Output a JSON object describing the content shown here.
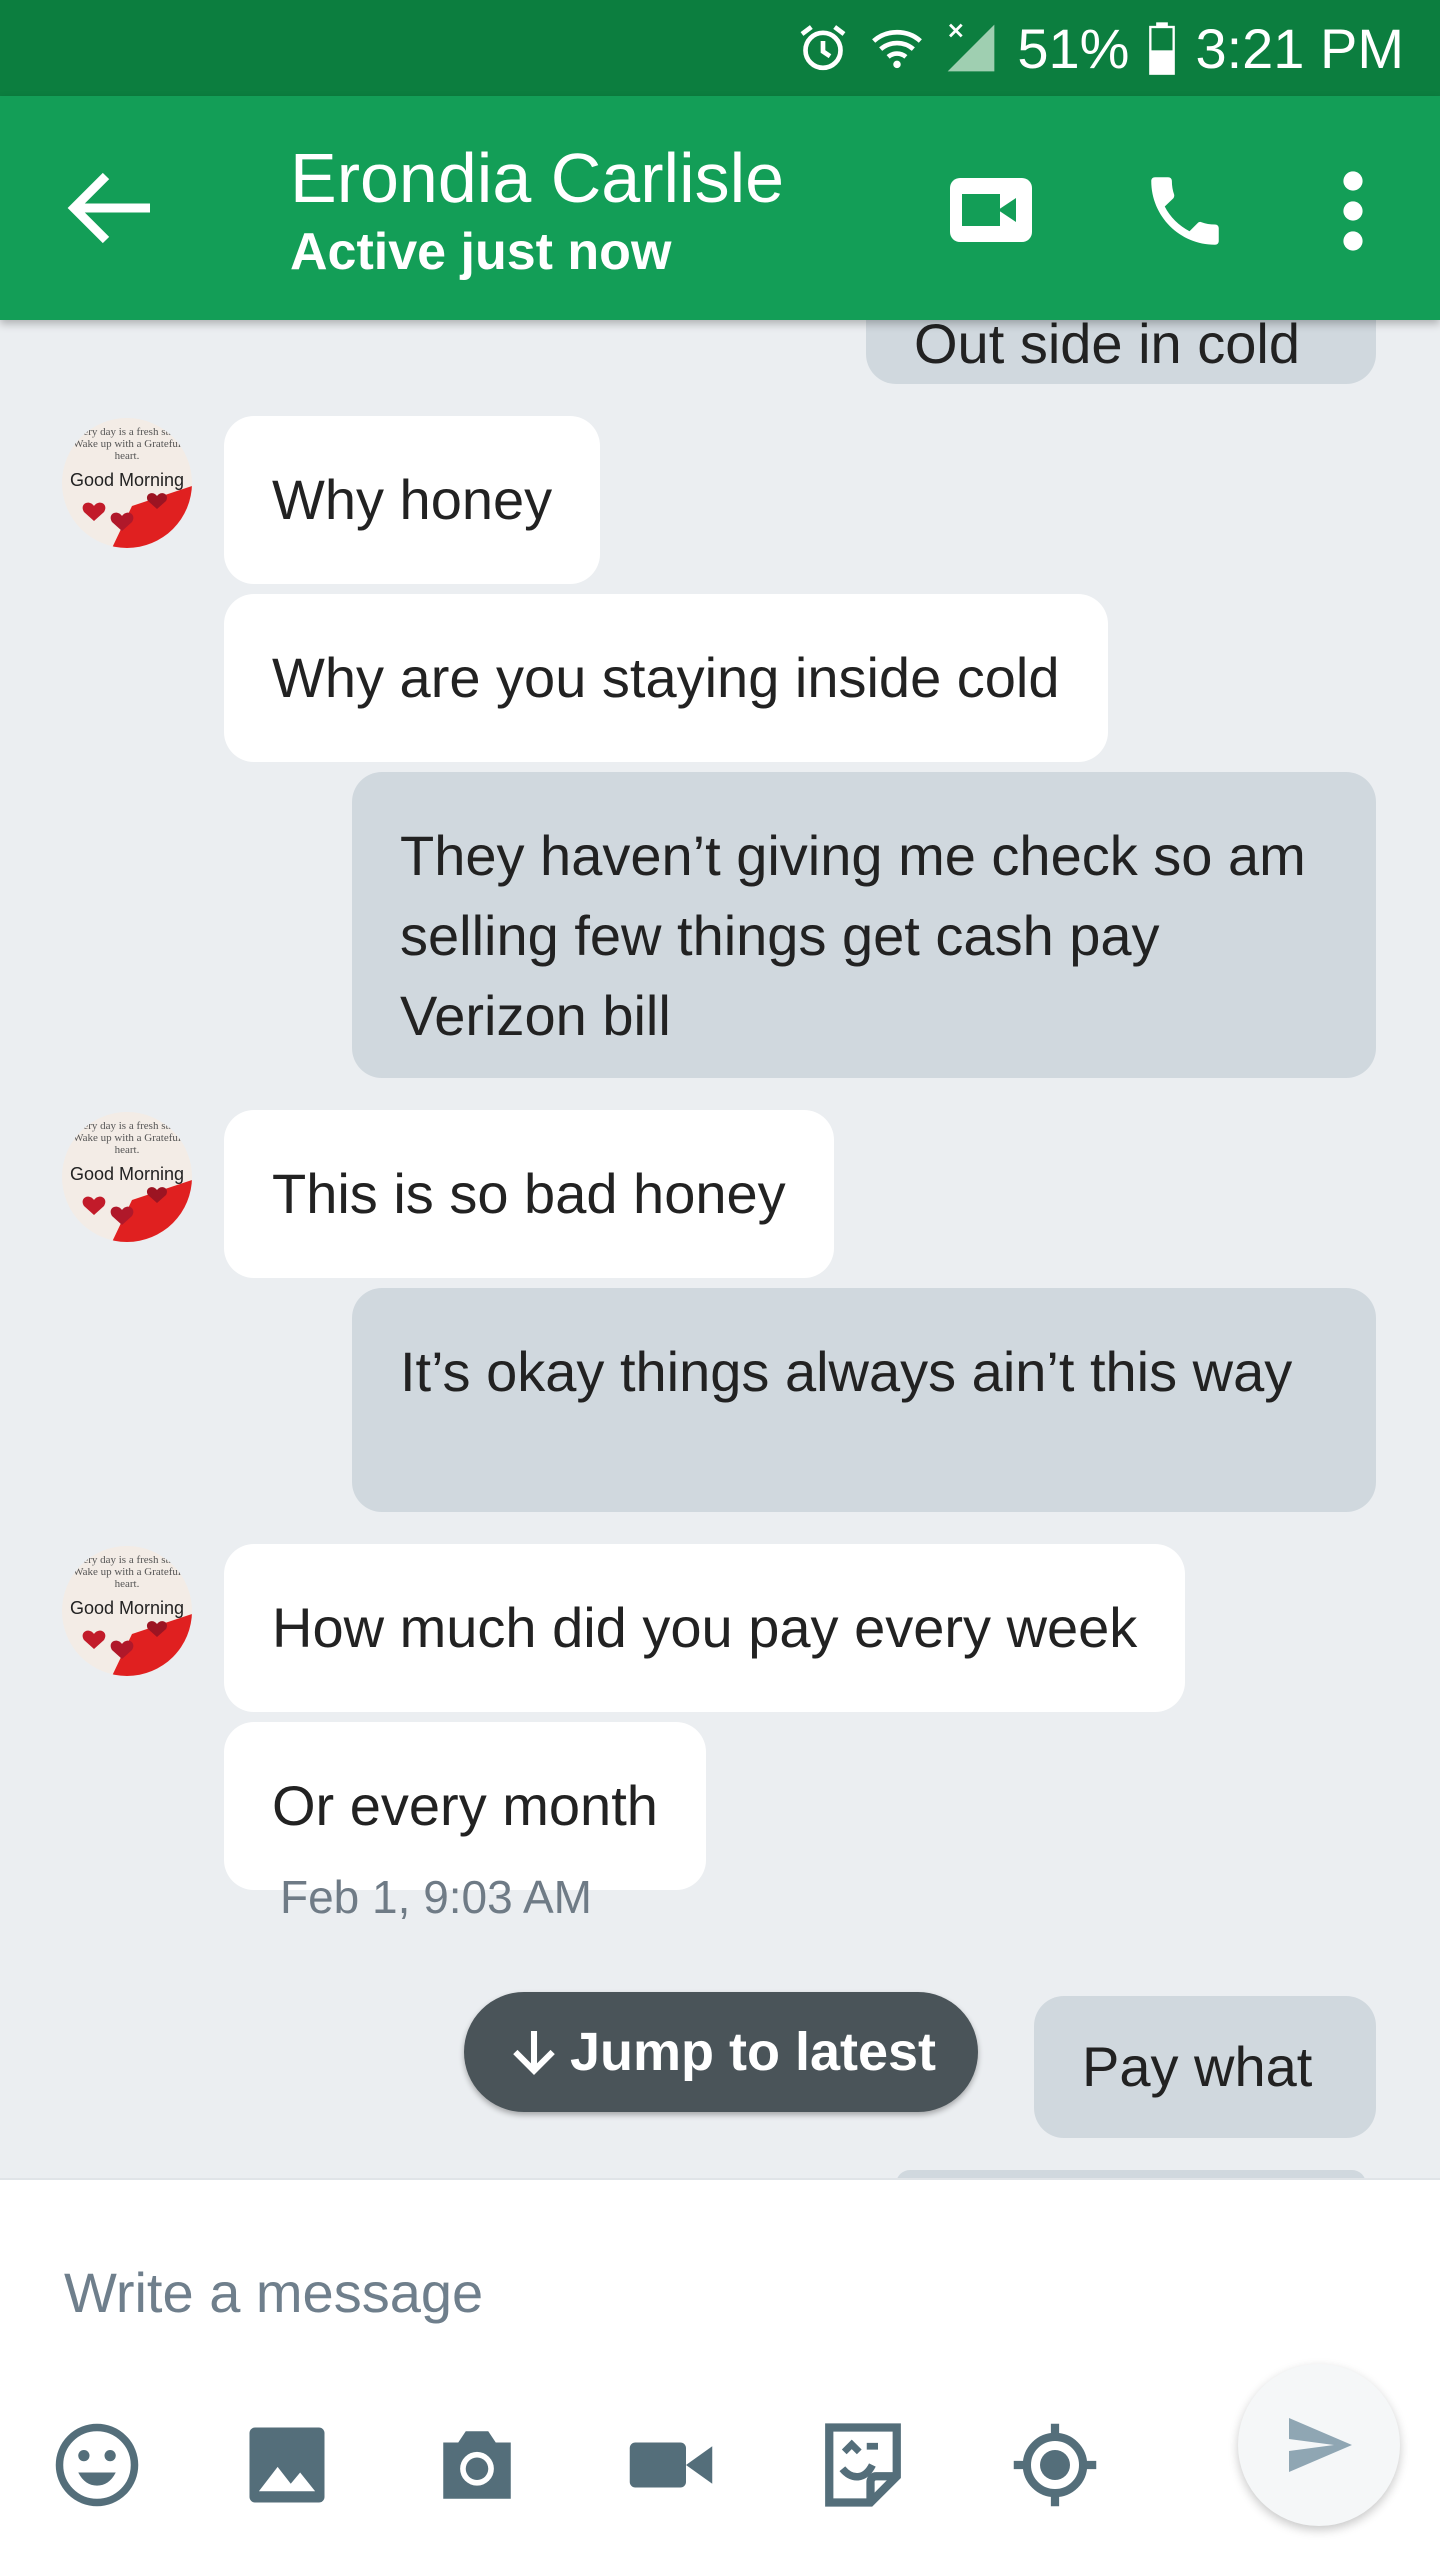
{
  "status_bar": {
    "battery": "51%",
    "time": "3:21 PM"
  },
  "header": {
    "contact_name": "Erondia Carlisle",
    "status": "Active just now"
  },
  "avatar": {
    "wish_text": "Every day is a fresh start. Wake up with a Grateful heart.",
    "label": "Good Morning"
  },
  "messages": [
    {
      "side": "out",
      "text": "Out side in cold"
    },
    {
      "side": "in",
      "text": "Why honey"
    },
    {
      "side": "in",
      "text": "Why are you staying inside cold"
    },
    {
      "side": "out",
      "text": "They haven’t giving me check so am selling few things get cash pay Verizon bill"
    },
    {
      "side": "in",
      "text": "This is so bad honey"
    },
    {
      "side": "out",
      "text": "It’s okay things always ain’t this way"
    },
    {
      "side": "in",
      "text": "How much did you pay every week"
    },
    {
      "side": "in",
      "text": "Or every month"
    },
    {
      "side": "out",
      "text": "Pay what"
    }
  ],
  "timestamp": "Feb 1, 9:03 AM",
  "jump_to_latest": "Jump to latest",
  "composer": {
    "placeholder": "Write a message"
  },
  "colors": {
    "status_bar": "#0c7e3f",
    "app_bar": "#139e57",
    "chat_background": "#ebeef1",
    "incoming_bubble": "#ffffff",
    "outgoing_bubble": "#d0d8de",
    "jump_button": "#4a5459",
    "icon_gray": "#546e7a"
  },
  "icons": [
    "alarm-icon",
    "wifi-icon",
    "signal-icon",
    "battery-icon",
    "back-arrow-icon",
    "video-call-icon",
    "phone-icon",
    "more-vert-icon",
    "arrow-down-icon",
    "emoji-icon",
    "image-icon",
    "camera-icon",
    "video-icon",
    "sticker-icon",
    "location-icon",
    "send-icon"
  ]
}
